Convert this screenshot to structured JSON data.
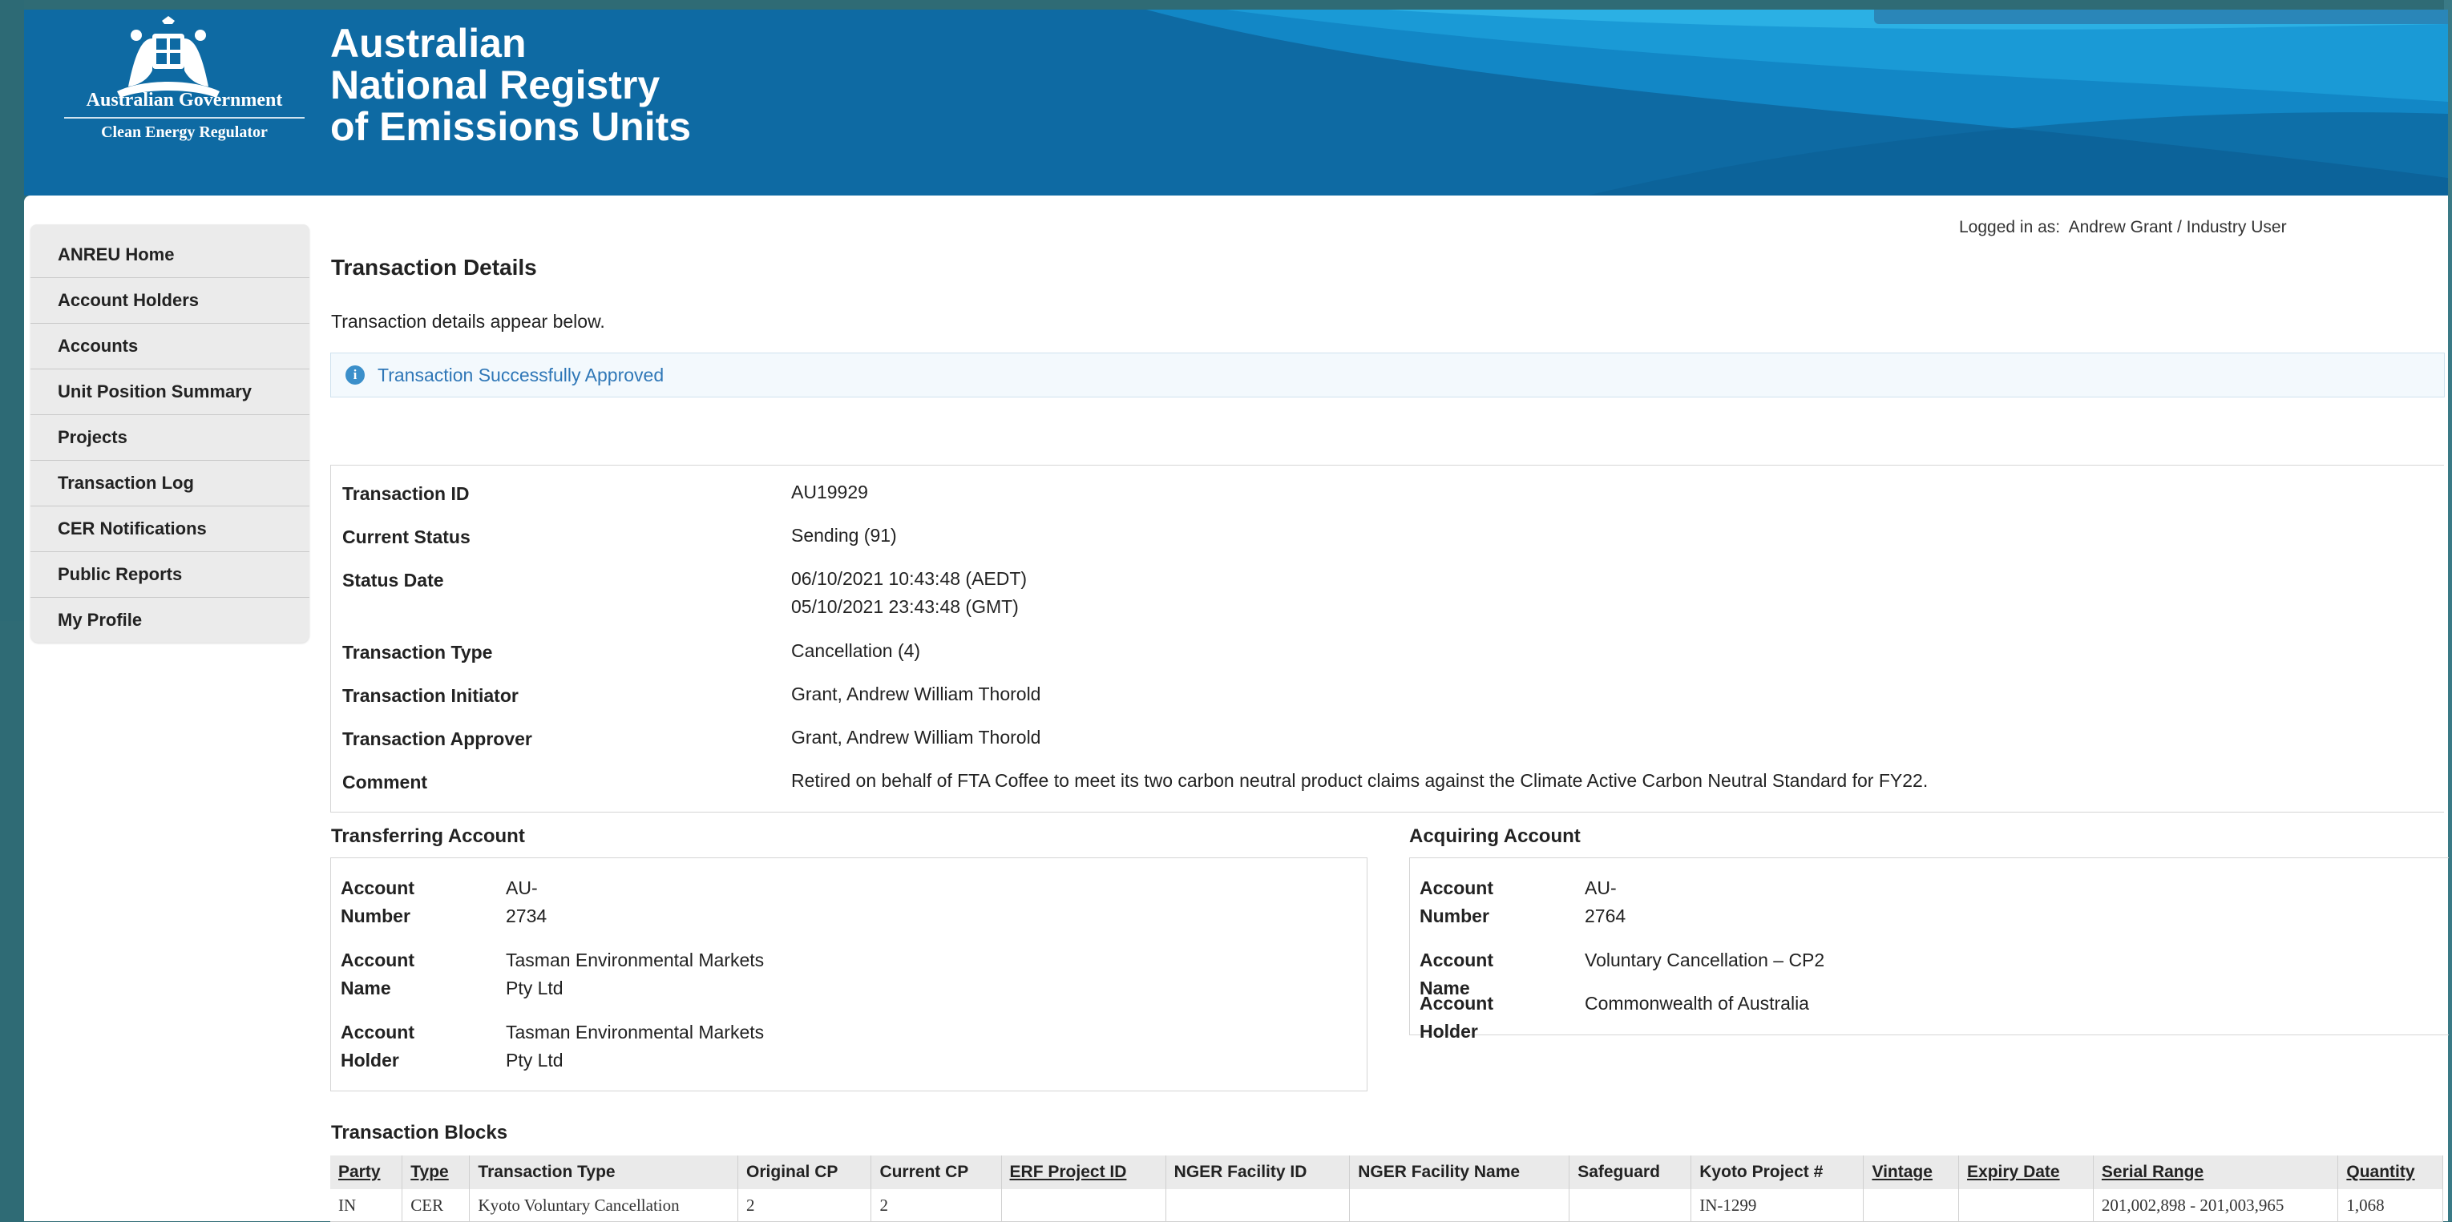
{
  "header": {
    "gov_name": "Australian Government",
    "gov_sub": "Clean Energy Regulator",
    "title_line1": "Australian",
    "title_line2": "National Registry",
    "title_line3": "of Emissions Units"
  },
  "sidebar": {
    "items": [
      {
        "label": "ANREU Home"
      },
      {
        "label": "Account Holders"
      },
      {
        "label": "Accounts"
      },
      {
        "label": "Unit Position Summary"
      },
      {
        "label": "Projects"
      },
      {
        "label": "Transaction Log"
      },
      {
        "label": "CER Notifications"
      },
      {
        "label": "Public Reports"
      },
      {
        "label": "My Profile"
      }
    ]
  },
  "user": {
    "logged_in_label": "Logged in as:",
    "logged_in_value": "Andrew Grant / Industry User"
  },
  "main": {
    "page_title": "Transaction Details",
    "intro": "Transaction details appear below.",
    "info_message": "Transaction Successfully Approved"
  },
  "details": {
    "transaction_id_label": "Transaction ID",
    "transaction_id": "AU19929",
    "current_status_label": "Current Status",
    "current_status": "Sending (91)",
    "status_date_label": "Status Date",
    "status_date_local": "06/10/2021 10:43:48 (AEDT)",
    "status_date_gmt": "05/10/2021 23:43:48 (GMT)",
    "transaction_type_label": "Transaction Type",
    "transaction_type": "Cancellation (4)",
    "initiator_label": "Transaction Initiator",
    "initiator": "Grant, Andrew William Thorold",
    "approver_label": "Transaction Approver",
    "approver": "Grant, Andrew William Thorold",
    "comment_label": "Comment",
    "comment": "Retired on behalf of FTA Coffee to meet its two carbon neutral product claims against the Climate Active Carbon Neutral Standard for FY22."
  },
  "transferring": {
    "title": "Transferring Account",
    "number_label_1": "Account",
    "number_label_2": "Number",
    "number": "AU-2734",
    "name_label": "Account Name",
    "name_1": "Tasman Environmental Markets",
    "name_2": "Pty Ltd",
    "holder_label": "Account Holder",
    "holder_1": "Tasman Environmental Markets",
    "holder_2": "Pty Ltd"
  },
  "acquiring": {
    "title": "Acquiring Account",
    "number_label_1": "Account",
    "number_label_2": "Number",
    "number": "AU-2764",
    "name_label": "Account Name",
    "name": "Voluntary Cancellation – CP2",
    "holder_label": "Account Holder",
    "holder": "Commonwealth of Australia"
  },
  "blocks": {
    "title": "Transaction Blocks",
    "columns": [
      "Party",
      "Type",
      "Transaction Type",
      "Original CP",
      "Current CP",
      "ERF Project ID",
      "NGER Facility ID",
      "NGER Facility Name",
      "Safeguard",
      "Kyoto Project #",
      "Vintage",
      "Expiry Date",
      "Serial Range",
      "Quantity"
    ],
    "rows": [
      [
        "IN",
        "CER",
        "Kyoto Voluntary Cancellation",
        "2",
        "2",
        "",
        "",
        "",
        "",
        "IN-1299",
        "",
        "",
        "201,002,898 - 201,003,965",
        "1,068"
      ]
    ]
  },
  "colors": {
    "header_blue": "#0e6aa3",
    "info_text": "#2f77b7",
    "info_icon": "#3b8fca"
  }
}
